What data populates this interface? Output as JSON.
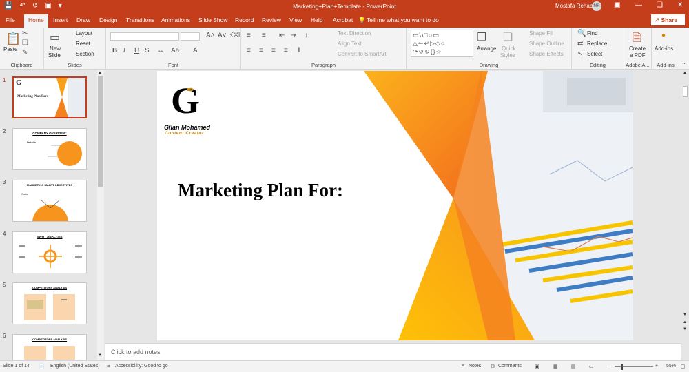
{
  "app": {
    "title": "Marketing+Plan+Template  -  PowerPoint",
    "user": "Mostafa Rehab",
    "avatar_initials": "MR",
    "share_label": "Share",
    "accent_color": "#c43e1c"
  },
  "tabs": [
    "File",
    "Home",
    "Insert",
    "Draw",
    "Design",
    "Transitions",
    "Animations",
    "Slide Show",
    "Record",
    "Review",
    "View",
    "Help",
    "Acrobat"
  ],
  "active_tab": "Home",
  "tell_me": "Tell me what you want to do",
  "ribbon": {
    "clipboard": {
      "label": "Clipboard",
      "paste": "Paste"
    },
    "slides": {
      "label": "Slides",
      "new_slide_1": "New",
      "new_slide_2": "Slide",
      "layout": "Layout",
      "reset": "Reset",
      "section": "Section"
    },
    "font": {
      "label": "Font"
    },
    "paragraph": {
      "label": "Paragraph",
      "text_direction": "Text Direction",
      "align_text": "Align Text",
      "convert": "Convert to SmartArt"
    },
    "drawing": {
      "label": "Drawing",
      "arrange": "Arrange",
      "quick_styles_1": "Quick",
      "quick_styles_2": "Styles",
      "shape_fill": "Shape Fill",
      "shape_outline": "Shape Outline",
      "shape_effects": "Shape Effects"
    },
    "editing": {
      "label": "Editing",
      "find": "Find",
      "replace": "Replace",
      "select": "Select"
    },
    "adobe": {
      "label": "Adobe A...",
      "create_1": "Create",
      "create_2": "a PDF"
    },
    "addins": {
      "label": "Add-ins",
      "button": "Add-ins"
    }
  },
  "thumbnails": [
    {
      "num": "1",
      "title": "Marketing Plan For:"
    },
    {
      "num": "2",
      "title": "COMPANY OVERVIEW:",
      "sub": "Details"
    },
    {
      "num": "3",
      "title": "MARKETING SMART OBJECTIVES",
      "sub": "Goals"
    },
    {
      "num": "4",
      "title": "SWOT ANALYSIS"
    },
    {
      "num": "5",
      "title": "COMPETITORS ANALYSIS"
    },
    {
      "num": "6",
      "title": "COMPETITORS ANALYSIS"
    }
  ],
  "slide": {
    "title": "Marketing Plan For:",
    "logo_letter": "G",
    "logo_name": "Gilan Mohamed",
    "logo_subtitle": "Content Creator"
  },
  "notes_placeholder": "Click to add notes",
  "status": {
    "slide_count": "Slide 1 of 14",
    "language": "English (United States)",
    "accessibility": "Accessibility: Good to go",
    "notes": "Notes",
    "comments": "Comments",
    "zoom": "55%"
  }
}
